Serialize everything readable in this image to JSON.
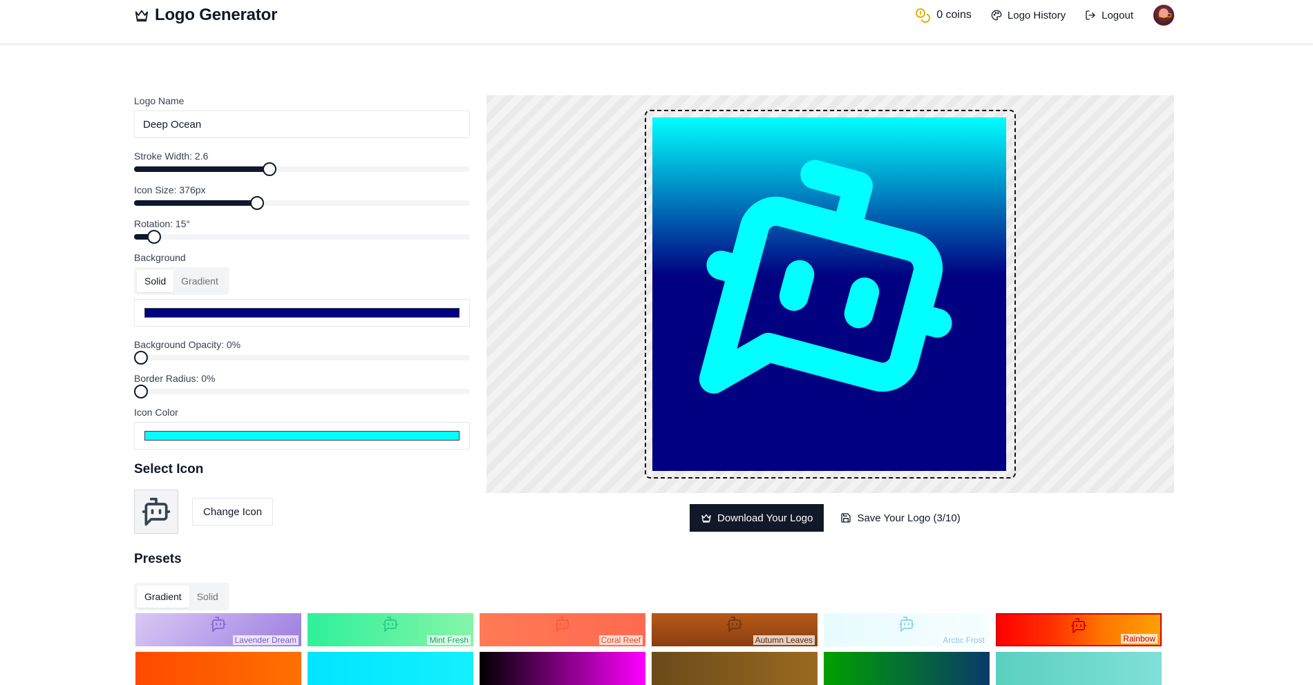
{
  "header": {
    "title": "Logo Generator",
    "coins": "0 coins",
    "history": "Logo History",
    "logout": "Logout"
  },
  "controls": {
    "logo_name_label": "Logo Name",
    "logo_name_value": "Deep Ocean",
    "stroke_label": "Stroke Width: 2.6",
    "stroke_fraction": 0.4,
    "size_label": "Icon Size: 376px",
    "size_fraction": 0.36,
    "rotation_label": "Rotation: 15°",
    "rotation_fraction": 0.04,
    "background_label": "Background",
    "bg_tabs": [
      "Solid",
      "Gradient"
    ],
    "bg_color": "#000080",
    "bg_opacity_label": "Background Opacity: 0%",
    "bg_opacity_fraction": 0,
    "radius_label": "Border Radius: 0%",
    "radius_fraction": 0,
    "icon_color_label": "Icon Color",
    "icon_color": "#00ffff",
    "select_icon_title": "Select Icon",
    "change_icon": "Change Icon"
  },
  "preview": {
    "download": "Download Your Logo",
    "save": "Save Your Logo (3/10)"
  },
  "presets": {
    "title": "Presets",
    "tabs": [
      "Gradient",
      "Solid"
    ],
    "items": [
      {
        "name": "Lavender Dream",
        "bg": "linear-gradient(135deg,#d8c8f5,#9d7ee0)",
        "icon": "#8b6ad6",
        "label_color": "#7c5cc4"
      },
      {
        "name": "Mint Fresh",
        "bg": "linear-gradient(90deg,#2ef09a,#86f5a8)",
        "icon": "#2ad08a",
        "label_color": "#12a060"
      },
      {
        "name": "Coral Reef",
        "bg": "linear-gradient(90deg,#ff7a55,#ff6a50)",
        "icon": "#ff5a40",
        "label_color": "#e24a2a"
      },
      {
        "name": "Autumn Leaves",
        "bg": "linear-gradient(180deg,#b65a18,#8a3e10)",
        "icon": "#7a3510",
        "label_color": "#5a2a08"
      },
      {
        "name": "Arctic Frost",
        "bg": "linear-gradient(90deg,#e8fbff,#f6feff)",
        "icon": "#8fd8f0",
        "label_color": "#7ac8e4"
      },
      {
        "name": "Rainbow",
        "bg": "linear-gradient(90deg,#ff0000,#ff3000,#ff7a00,#ffa000)",
        "icon": "#d80000",
        "label_color": "#c00000"
      }
    ],
    "row2": [
      "linear-gradient(90deg,#ff4a00,#ff7000)",
      "linear-gradient(90deg,#00e5ff,#14f0ff)",
      "linear-gradient(90deg,#000000,#ff00ff)",
      "linear-gradient(90deg,#6b4a1a,#9a6a20)",
      "linear-gradient(90deg,#00a000,#0a3a6a)",
      "linear-gradient(90deg,#5ad0c0,#80e0d8)"
    ]
  }
}
